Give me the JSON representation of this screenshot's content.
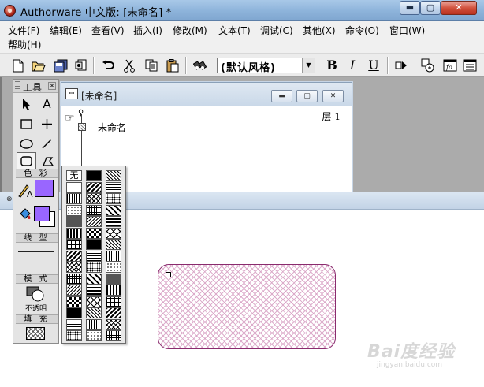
{
  "window": {
    "title": "Authorware 中文版: [未命名] *",
    "min_glyph": "▬",
    "max_glyph": "▢",
    "close_glyph": "✕"
  },
  "menu": {
    "items": [
      "文件(F)",
      "编辑(E)",
      "查看(V)",
      "插入(I)",
      "修改(M)",
      "文本(T)",
      "调试(C)",
      "其他(X)",
      "命令(O)",
      "窗口(W)",
      "帮助(H)"
    ]
  },
  "toolbar": {
    "style_value": "(默认风格)",
    "bold": "B",
    "italic": "I",
    "underline": "U",
    "icons": [
      "new-icon",
      "open-icon",
      "save-all-icon",
      "import-icon",
      "undo-icon",
      "cut-icon",
      "copy-icon",
      "paste-icon",
      "find-icon",
      "run-icon",
      "control-panel-icon",
      "functions-icon",
      "variables-icon"
    ]
  },
  "design_window": {
    "title": "[未命名]",
    "node_label": "未命名",
    "layer": "层 1"
  },
  "tools": {
    "title": "工具",
    "color_label": "色 彩",
    "line_label": "线 型",
    "mode_label": "模 式",
    "mode_value": "不透明",
    "fill_label": "填 充",
    "colors": {
      "pen": "#9966ff",
      "fill_fg": "#9966ff",
      "fill_bg": "#ffffff"
    }
  },
  "pattern_palette": {
    "none_label": "无"
  },
  "watermark": {
    "brand": "Bai度经验",
    "url": "jingyan.baidu.com"
  }
}
